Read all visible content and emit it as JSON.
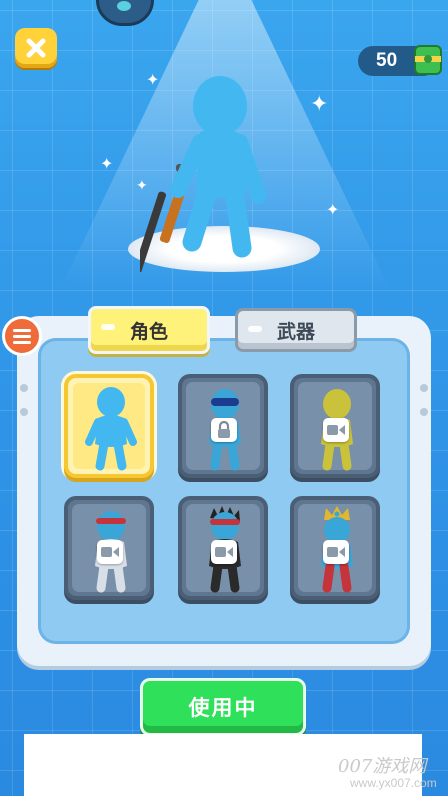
{
  "header": {
    "close_icon": "close-x-icon",
    "currency": {
      "amount": "50",
      "icon": "cash-bundle-icon"
    }
  },
  "tabs": [
    {
      "label": "角色",
      "active": true
    },
    {
      "label": "武器",
      "active": false
    }
  ],
  "character_grid": [
    {
      "name": "plain-blue",
      "state": "selected",
      "overlay": "none"
    },
    {
      "name": "goggles-blue",
      "state": "locked",
      "overlay": "lock-icon"
    },
    {
      "name": "yellow-robot",
      "state": "locked",
      "overlay": "video-ad-icon"
    },
    {
      "name": "red-headband",
      "state": "locked",
      "overlay": "video-ad-icon"
    },
    {
      "name": "spiky-hair-ninja",
      "state": "locked",
      "overlay": "video-ad-icon"
    },
    {
      "name": "crowned-king",
      "state": "locked",
      "overlay": "video-ad-icon"
    }
  ],
  "action_button": {
    "label": "使用中"
  },
  "watermark": {
    "brand": "007游戏网",
    "url": "www.yx007.com"
  },
  "colors": {
    "background": "#2f93e6",
    "accent_yellow": "#ffd23a",
    "active_tab": "#fff27a",
    "use_button": "#2fe05a",
    "menu_button": "#f06b3a",
    "character_blue": "#43b8f0"
  }
}
